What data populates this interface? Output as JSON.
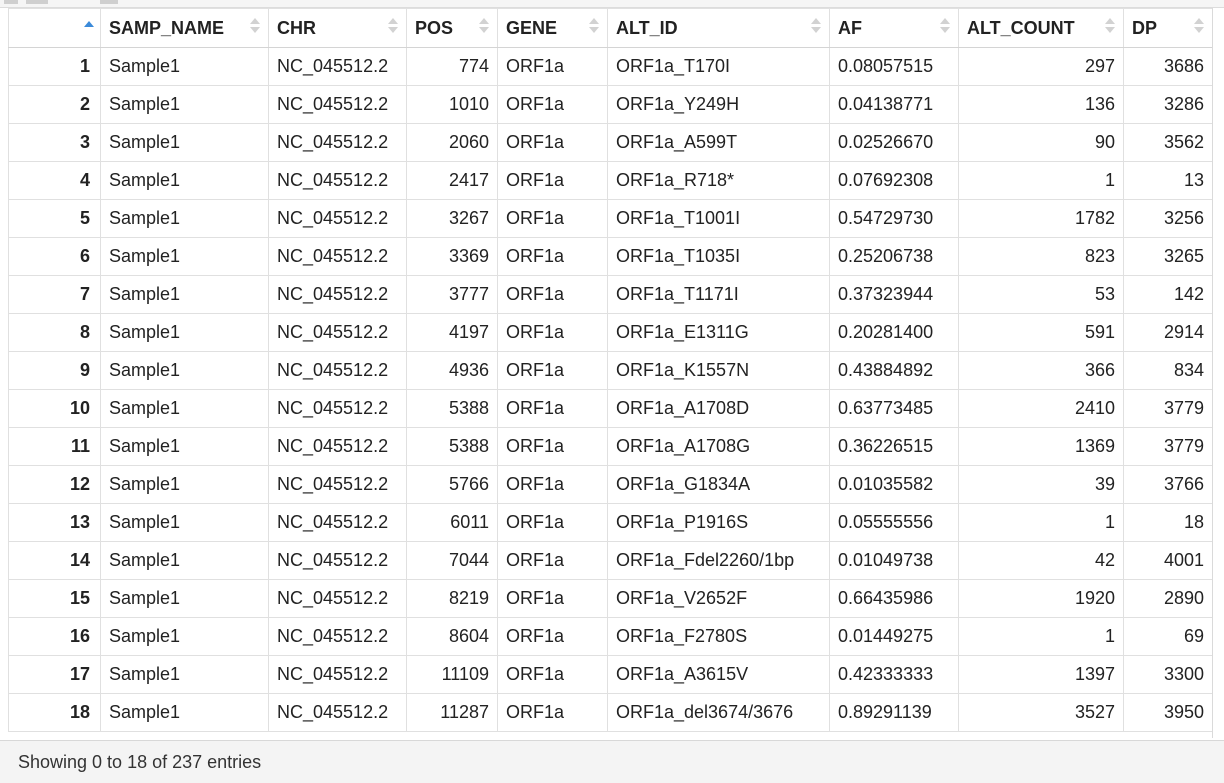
{
  "table": {
    "columns": [
      "",
      "SAMP_NAME",
      "CHR",
      "POS",
      "GENE",
      "ALT_ID",
      "AF",
      "ALT_COUNT",
      "DP"
    ],
    "sorted_column": 0,
    "sort_direction": "ascending",
    "rows": [
      [
        "1",
        "Sample1",
        "NC_045512.2",
        "774",
        "ORF1a",
        "ORF1a_T170I",
        "0.08057515",
        "297",
        "3686"
      ],
      [
        "2",
        "Sample1",
        "NC_045512.2",
        "1010",
        "ORF1a",
        "ORF1a_Y249H",
        "0.04138771",
        "136",
        "3286"
      ],
      [
        "3",
        "Sample1",
        "NC_045512.2",
        "2060",
        "ORF1a",
        "ORF1a_A599T",
        "0.02526670",
        "90",
        "3562"
      ],
      [
        "4",
        "Sample1",
        "NC_045512.2",
        "2417",
        "ORF1a",
        "ORF1a_R718*",
        "0.07692308",
        "1",
        "13"
      ],
      [
        "5",
        "Sample1",
        "NC_045512.2",
        "3267",
        "ORF1a",
        "ORF1a_T1001I",
        "0.54729730",
        "1782",
        "3256"
      ],
      [
        "6",
        "Sample1",
        "NC_045512.2",
        "3369",
        "ORF1a",
        "ORF1a_T1035I",
        "0.25206738",
        "823",
        "3265"
      ],
      [
        "7",
        "Sample1",
        "NC_045512.2",
        "3777",
        "ORF1a",
        "ORF1a_T1171I",
        "0.37323944",
        "53",
        "142"
      ],
      [
        "8",
        "Sample1",
        "NC_045512.2",
        "4197",
        "ORF1a",
        "ORF1a_E1311G",
        "0.20281400",
        "591",
        "2914"
      ],
      [
        "9",
        "Sample1",
        "NC_045512.2",
        "4936",
        "ORF1a",
        "ORF1a_K1557N",
        "0.43884892",
        "366",
        "834"
      ],
      [
        "10",
        "Sample1",
        "NC_045512.2",
        "5388",
        "ORF1a",
        "ORF1a_A1708D",
        "0.63773485",
        "2410",
        "3779"
      ],
      [
        "11",
        "Sample1",
        "NC_045512.2",
        "5388",
        "ORF1a",
        "ORF1a_A1708G",
        "0.36226515",
        "1369",
        "3779"
      ],
      [
        "12",
        "Sample1",
        "NC_045512.2",
        "5766",
        "ORF1a",
        "ORF1a_G1834A",
        "0.01035582",
        "39",
        "3766"
      ],
      [
        "13",
        "Sample1",
        "NC_045512.2",
        "6011",
        "ORF1a",
        "ORF1a_P1916S",
        "0.05555556",
        "1",
        "18"
      ],
      [
        "14",
        "Sample1",
        "NC_045512.2",
        "7044",
        "ORF1a",
        "ORF1a_Fdel2260/1bp",
        "0.01049738",
        "42",
        "4001"
      ],
      [
        "15",
        "Sample1",
        "NC_045512.2",
        "8219",
        "ORF1a",
        "ORF1a_V2652F",
        "0.66435986",
        "1920",
        "2890"
      ],
      [
        "16",
        "Sample1",
        "NC_045512.2",
        "8604",
        "ORF1a",
        "ORF1a_F2780S",
        "0.01449275",
        "1",
        "69"
      ],
      [
        "17",
        "Sample1",
        "NC_045512.2",
        "11109",
        "ORF1a",
        "ORF1a_A3615V",
        "0.42333333",
        "1397",
        "3300"
      ],
      [
        "18",
        "Sample1",
        "NC_045512.2",
        "11287",
        "ORF1a",
        "ORF1a_del3674/3676",
        "0.89291139",
        "3527",
        "3950"
      ]
    ]
  },
  "footer": {
    "status_text": "Showing 0 to 18 of 237 entries"
  },
  "colors": {
    "sort_active": "#3b8ad9",
    "sort_inactive": "#d2d2d2"
  },
  "icons": {
    "sort": "sort-arrows-icon",
    "sort_active": "sort-ascending-icon"
  }
}
